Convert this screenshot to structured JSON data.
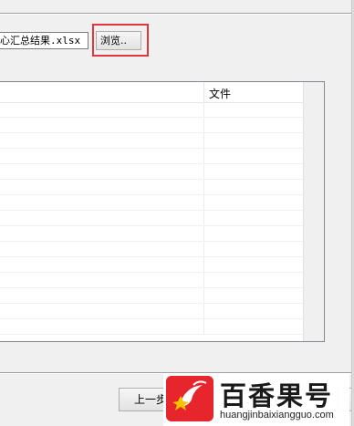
{
  "path_field": {
    "value": "汇总结果.xlsx",
    "visible_text": "心汇总结果.xlsx"
  },
  "browse_button": {
    "label": "浏览.."
  },
  "file_list": {
    "columns": [
      {
        "label": ""
      },
      {
        "label": "文件"
      }
    ],
    "rows": []
  },
  "footer": {
    "prev_button": {
      "label": "上一步"
    }
  },
  "watermark": {
    "title": "百香果号",
    "url": "huangjinbaixiangguo.com"
  },
  "colors": {
    "highlight": "#e0363c",
    "brand": "#e6252c"
  }
}
